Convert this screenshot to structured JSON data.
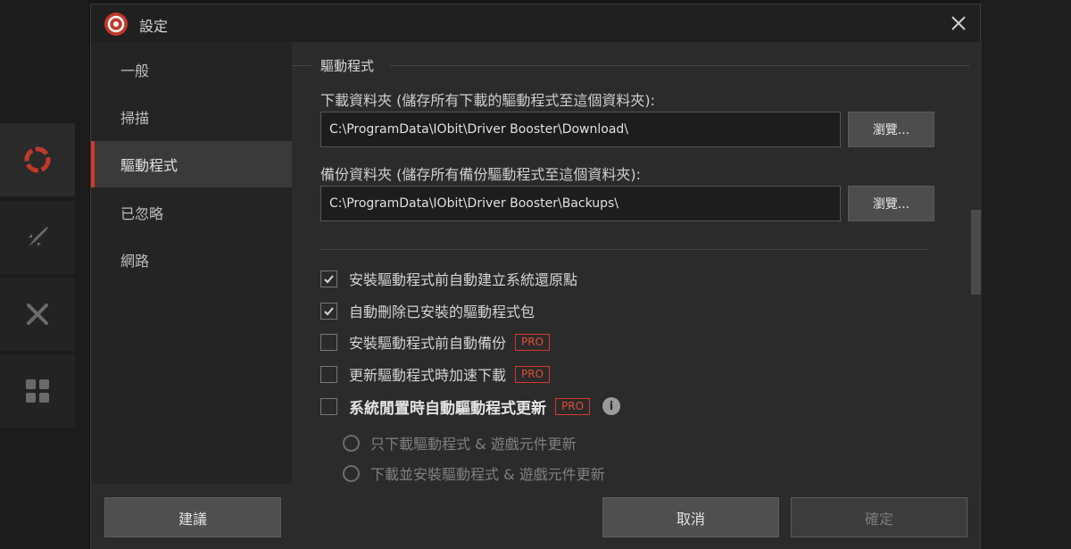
{
  "dialog": {
    "title": "設定"
  },
  "sidebar": {
    "items": [
      {
        "label": "一般"
      },
      {
        "label": "掃描"
      },
      {
        "label": "驅動程式"
      },
      {
        "label": "已忽略"
      },
      {
        "label": "網路"
      }
    ],
    "active_index": 2
  },
  "content": {
    "section_title": "驅動程式",
    "download_folder": {
      "label": "下載資料夾 (儲存所有下載的驅動程式至這個資料夾):",
      "value": "C:\\ProgramData\\IObit\\Driver Booster\\Download\\",
      "browse_label": "瀏覽..."
    },
    "backup_folder": {
      "label": "備份資料夾 (儲存所有備份驅動程式至這個資料夾):",
      "value": "C:\\ProgramData\\IObit\\Driver Booster\\Backups\\",
      "browse_label": "瀏覽..."
    },
    "options": [
      {
        "label": "安裝驅動程式前自動建立系統還原點",
        "checked": true,
        "pro": false
      },
      {
        "label": "自動刪除已安裝的驅動程式包",
        "checked": true,
        "pro": false
      },
      {
        "label": "安裝驅動程式前自動備份",
        "checked": false,
        "pro": true
      },
      {
        "label": "更新驅動程式時加速下載",
        "checked": false,
        "pro": true
      },
      {
        "label": "系統閒置時自動驅動程式更新",
        "checked": false,
        "pro": true
      }
    ],
    "pro_badge": "PRO",
    "radio_options": [
      {
        "label": "只下載驅動程式 & 遊戲元件更新"
      },
      {
        "label": "下載並安裝驅動程式 & 遊戲元件更新"
      }
    ]
  },
  "footer": {
    "suggest_label": "建議",
    "cancel_label": "取消",
    "ok_label": "確定"
  },
  "colors": {
    "accent": "#d23a2a",
    "dialog_bg": "#2b2b2b",
    "sidebar_bg": "#242424"
  }
}
